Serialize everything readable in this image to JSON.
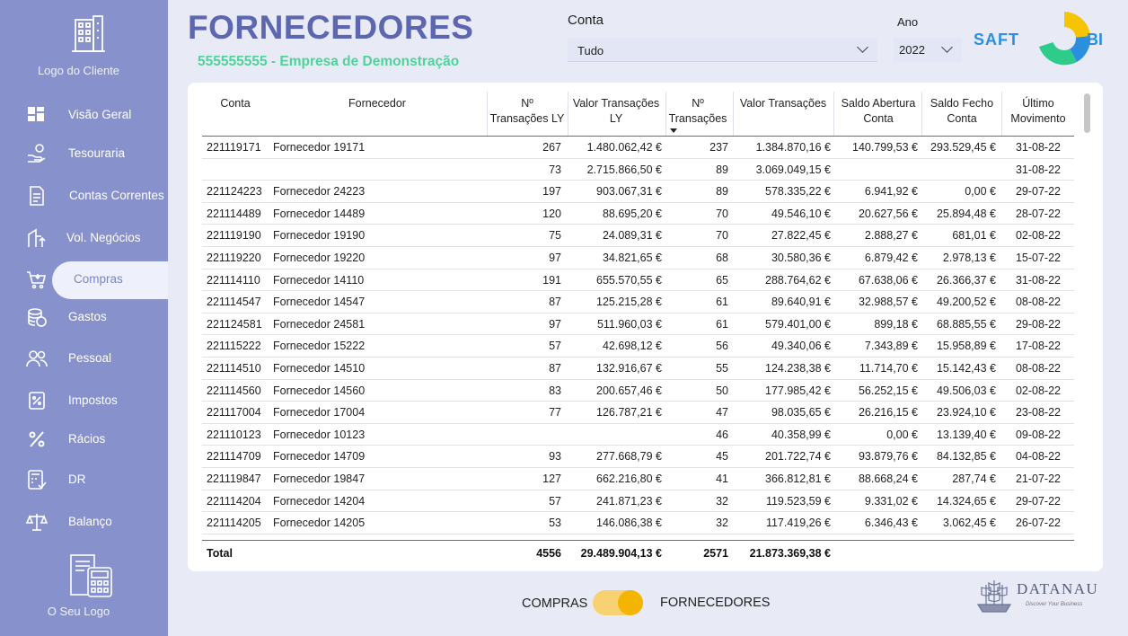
{
  "sidebar": {
    "client_logo_label": "Logo do Cliente",
    "your_logo_label": "O Seu Logo",
    "items": [
      {
        "label": "Visão Geral",
        "icon": "dashboard-icon"
      },
      {
        "label": "Tesouraria",
        "icon": "hand-coin-icon"
      },
      {
        "label": "Contas Correntes",
        "icon": "document-icon"
      },
      {
        "label": "Vol. Negócios",
        "icon": "building-up-icon"
      },
      {
        "label": "Compras",
        "icon": "cart-icon",
        "active": true
      },
      {
        "label": "Gastos",
        "icon": "coins-icon"
      },
      {
        "label": "Pessoal",
        "icon": "people-icon"
      },
      {
        "label": "Impostos",
        "icon": "percent-box-icon"
      },
      {
        "label": "Rácios",
        "icon": "percent-icon"
      },
      {
        "label": "DR",
        "icon": "calculator-icon"
      },
      {
        "label": "Balanço",
        "icon": "scale-icon"
      }
    ]
  },
  "header": {
    "title": "FORNECEDORES",
    "subtitle": "555555555 - Empresa de Demonstração",
    "conta_label": "Conta",
    "conta_value": "Tudo",
    "ano_label": "Ano",
    "ano_value": "2022",
    "saft_logo_left": "SAFT",
    "saft_logo_right": "BI"
  },
  "table": {
    "columns": [
      "Conta",
      "Fornecedor",
      "Nº Transações LY",
      "Valor Transações LY",
      "Nº Transações",
      "Valor Transações",
      "Saldo Abertura Conta",
      "Saldo Fecho Conta",
      "Último Movimento"
    ],
    "header_lines": {
      "conta": "Conta",
      "fornecedor": "Fornecedor",
      "ntly_1": "Nº",
      "ntly_2": "Transações LY",
      "vtly_1": "Valor Transações",
      "vtly_2": "LY",
      "nt_1": "Nº",
      "nt_2": "Transações",
      "vt": "Valor Transações",
      "sa_1": "Saldo Abertura",
      "sa_2": "Conta",
      "sf_1": "Saldo Fecho",
      "sf_2": "Conta",
      "um_1": "Último",
      "um_2": "Movimento"
    },
    "rows": [
      [
        "221119171",
        "Fornecedor 19171",
        "267",
        "1.480.062,42 €",
        "237",
        "1.384.870,16 €",
        "140.799,53 €",
        "293.529,45 €",
        "31-08-22"
      ],
      [
        "",
        "",
        "73",
        "2.715.866,50 €",
        "89",
        "3.069.049,15 €",
        "",
        "",
        "31-08-22"
      ],
      [
        "221124223",
        "Fornecedor 24223",
        "197",
        "903.067,31 €",
        "89",
        "578.335,22 €",
        "6.941,92 €",
        "0,00 €",
        "29-07-22"
      ],
      [
        "221114489",
        "Fornecedor 14489",
        "120",
        "88.695,20 €",
        "70",
        "49.546,10 €",
        "20.627,56 €",
        "25.894,48 €",
        "28-07-22"
      ],
      [
        "221119190",
        "Fornecedor 19190",
        "75",
        "24.089,31 €",
        "70",
        "27.822,45 €",
        "2.888,27 €",
        "681,01 €",
        "02-08-22"
      ],
      [
        "221119220",
        "Fornecedor 19220",
        "97",
        "34.821,65 €",
        "68",
        "30.580,36 €",
        "6.879,42 €",
        "2.978,13 €",
        "15-07-22"
      ],
      [
        "221114110",
        "Fornecedor 14110",
        "191",
        "655.570,55 €",
        "65",
        "288.764,62 €",
        "67.638,06 €",
        "26.366,37 €",
        "31-08-22"
      ],
      [
        "221114547",
        "Fornecedor 14547",
        "87",
        "125.215,28 €",
        "61",
        "89.640,91 €",
        "32.988,57 €",
        "49.200,52 €",
        "08-08-22"
      ],
      [
        "221124581",
        "Fornecedor 24581",
        "97",
        "511.960,03 €",
        "61",
        "579.401,00 €",
        "899,18 €",
        "68.885,55 €",
        "29-08-22"
      ],
      [
        "221115222",
        "Fornecedor 15222",
        "57",
        "42.698,12 €",
        "56",
        "49.340,06 €",
        "7.343,89 €",
        "15.958,89 €",
        "17-08-22"
      ],
      [
        "221114510",
        "Fornecedor 14510",
        "87",
        "132.916,67 €",
        "55",
        "124.238,38 €",
        "11.714,70 €",
        "15.142,43 €",
        "08-08-22"
      ],
      [
        "221114560",
        "Fornecedor 14560",
        "83",
        "200.657,46 €",
        "50",
        "177.985,42 €",
        "56.252,15 €",
        "49.506,03 €",
        "02-08-22"
      ],
      [
        "221117004",
        "Fornecedor 17004",
        "77",
        "126.787,21 €",
        "47",
        "98.035,65 €",
        "26.216,15 €",
        "23.924,10 €",
        "23-08-22"
      ],
      [
        "221110123",
        "Fornecedor 10123",
        "",
        "",
        "46",
        "40.358,99 €",
        "0,00 €",
        "13.139,40 €",
        "09-08-22"
      ],
      [
        "221114709",
        "Fornecedor 14709",
        "93",
        "277.668,79 €",
        "45",
        "201.722,74 €",
        "93.879,76 €",
        "84.132,85 €",
        "04-08-22"
      ],
      [
        "221119847",
        "Fornecedor 19847",
        "127",
        "662.216,80 €",
        "41",
        "366.812,81 €",
        "88.668,24 €",
        "287,74 €",
        "21-07-22"
      ],
      [
        "221114204",
        "Fornecedor 14204",
        "57",
        "241.871,23 €",
        "32",
        "119.523,59 €",
        "9.331,02 €",
        "14.324,65 €",
        "29-07-22"
      ],
      [
        "221114205",
        "Fornecedor 14205",
        "53",
        "146.086,38 €",
        "32",
        "117.419,26 €",
        "6.346,43 €",
        "3.062,45 €",
        "26-07-22"
      ]
    ],
    "total": {
      "label": "Total",
      "nt_ly": "4556",
      "vt_ly": "29.489.904,13 €",
      "nt": "2571",
      "vt": "21.873.369,38 €"
    }
  },
  "toggle": {
    "left_label": "COMPRAS",
    "right_label": "FORNECEDORES",
    "state": "FORNECEDORES"
  },
  "datanau": {
    "name": "DATANAU",
    "tagline": "Discover Your Business"
  },
  "colors": {
    "sidebar": "#8791cc",
    "title": "#5c67b0",
    "subtitle": "#4fd39a",
    "toggle": "#f4b400"
  }
}
